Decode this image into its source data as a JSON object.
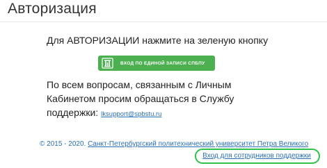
{
  "page": {
    "title": "Авторизация"
  },
  "auth": {
    "instruction": "Для АВТОРИЗАЦИИ нажмите на зеленую кнопку",
    "esia_button_label": "вход по единой записи спбпу",
    "esia_logo_icon": "spbpu-logo-icon"
  },
  "support": {
    "line1": "По всем вопросам, связанным с Личным",
    "line2": "Кабинетом просим обращаться в Службу",
    "line3_prefix": "поддержки:",
    "email": "lksupport@spbstu.ru"
  },
  "footer": {
    "copyright": "© 2015 - 2020.",
    "university_link": "Санкт-Петербургский политехнический университет Петра Великого"
  },
  "staff": {
    "link_label": "Вход для сотрудников поддержки"
  },
  "colors": {
    "button_green": "#4caf50",
    "link_blue": "#2a6fb8",
    "highlight_ring": "#2fc24a"
  }
}
